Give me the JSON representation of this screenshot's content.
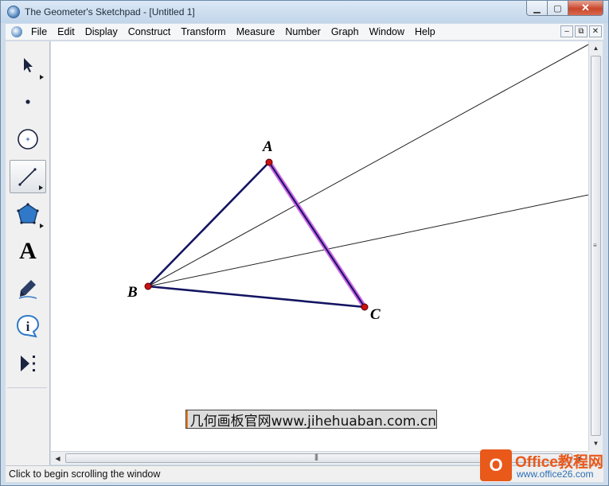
{
  "window": {
    "title": "The Geometer's Sketchpad - [Untitled 1]"
  },
  "menu": {
    "items": [
      "File",
      "Edit",
      "Display",
      "Construct",
      "Transform",
      "Measure",
      "Number",
      "Graph",
      "Window",
      "Help"
    ]
  },
  "toolbox": {
    "tools": [
      {
        "name": "arrow-tool-icon"
      },
      {
        "name": "point-tool-icon"
      },
      {
        "name": "compass-tool-icon"
      },
      {
        "name": "straightedge-tool-icon",
        "selected": true
      },
      {
        "name": "polygon-tool-icon"
      },
      {
        "name": "text-tool-icon",
        "glyph": "A"
      },
      {
        "name": "marker-tool-icon"
      },
      {
        "name": "information-tool-icon"
      },
      {
        "name": "custom-tool-icon"
      }
    ]
  },
  "sketch": {
    "points": [
      {
        "label": "A"
      },
      {
        "label": "B"
      },
      {
        "label": "C"
      }
    ],
    "colors": {
      "triangle": "#141462",
      "selected_highlight": "#cc66e6",
      "ray": "#222222",
      "point": "#cc1111"
    }
  },
  "status": {
    "text": "Click to begin scrolling the window"
  },
  "watermark": {
    "banner_text": "几何画板官网www.jihehuaban.com.cn",
    "brand": "Office教程网",
    "url": "www.office26.com"
  }
}
